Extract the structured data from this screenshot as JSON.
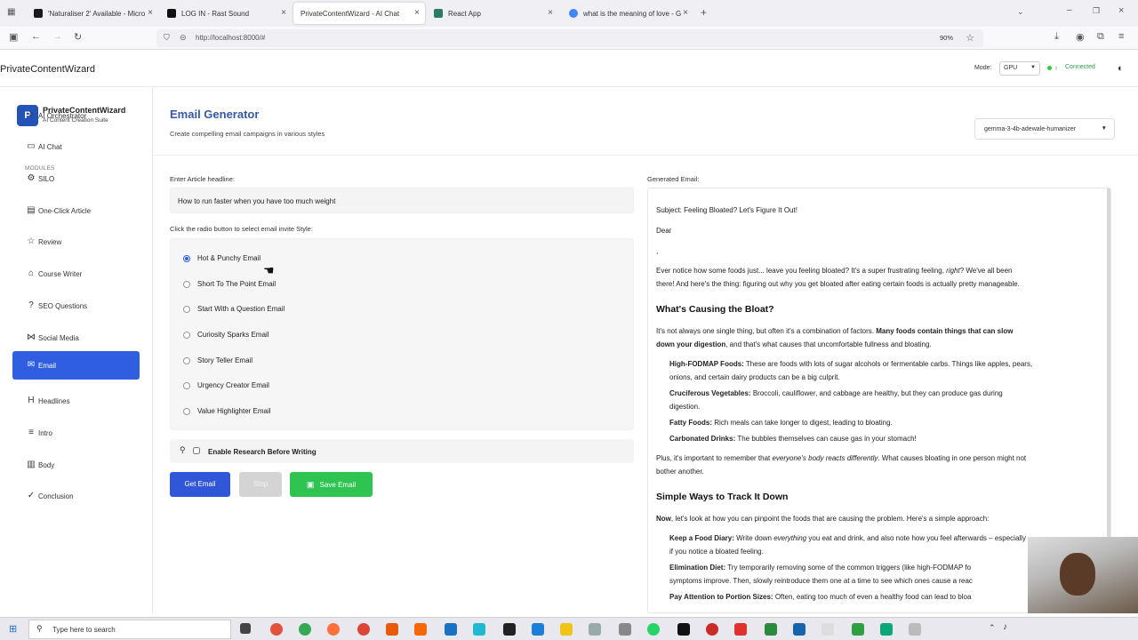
{
  "browser": {
    "tabs": [
      {
        "label": "'Naturaliser 2' Available - Micro",
        "color": "#1a1a1a"
      },
      {
        "label": "LOG IN - Rast Sound",
        "color": "#111111"
      },
      {
        "label": "PrivateContentWizard - AI Chat",
        "color": "#ffffff"
      },
      {
        "label": "React App",
        "color": "#2a7d5f"
      },
      {
        "label": "what is the meaning of love - G",
        "color": "#4285f4"
      }
    ],
    "url": "http://localhost:8000/#",
    "zoom": "90%"
  },
  "app": {
    "title": "PrivateContentWizard",
    "mode_label": "Mode:",
    "mode_value": "GPU",
    "status": "Connected"
  },
  "sidebar": {
    "brand_name": "PrivateContentWizard",
    "brand_sub": "AI Content Creation Suite",
    "logo_letter": "P",
    "modules_label": "MODULES",
    "items": [
      {
        "label": "AI Orchestrator",
        "icon": "sparkle-icon",
        "glyph": "✧"
      },
      {
        "label": "AI Chat",
        "icon": "chat-icon",
        "glyph": "▭"
      },
      {
        "label": "SILO",
        "icon": "silo-icon",
        "glyph": "⚙"
      },
      {
        "label": "One-Click Article",
        "icon": "document-icon",
        "glyph": "▤"
      },
      {
        "label": "Review",
        "icon": "star-icon",
        "glyph": "☆"
      },
      {
        "label": "Course Writer",
        "icon": "course-icon",
        "glyph": "⌂"
      },
      {
        "label": "SEO Questions",
        "icon": "question-icon",
        "glyph": "?"
      },
      {
        "label": "Social Media",
        "icon": "share-icon",
        "glyph": "⋈"
      },
      {
        "label": "Email",
        "icon": "mail-icon",
        "glyph": "✉"
      },
      {
        "label": "Headlines",
        "icon": "heading-icon",
        "glyph": "H"
      },
      {
        "label": "Intro",
        "icon": "intro-icon",
        "glyph": "≡"
      },
      {
        "label": "Body",
        "icon": "body-icon",
        "glyph": "▥"
      },
      {
        "label": "Conclusion",
        "icon": "check-circle-icon",
        "glyph": "✓"
      }
    ],
    "active_index": 8
  },
  "main": {
    "title": "Email Generator",
    "subtitle": "Create compelling email campaigns in various styles",
    "model": "gemma-3-4b-adewale-humanizer",
    "headline_label": "Enter Article headline:",
    "headline_value": "How to run faster when you have too much weight",
    "style_label": "Click the radio button to select email invite Style:",
    "styles": [
      "Hot & Punchy Email",
      "Short To The Point Email",
      "Start With a Question Email",
      "Curiosity Sparks Email",
      "Story Teller Email",
      "Urgency Creator Email",
      "Value Highlighter Email"
    ],
    "selected_style": 0,
    "research_label": "Enable Research Before Writing",
    "buttons": {
      "get": "Get Email",
      "stop": "Stop",
      "save": "Save Email"
    }
  },
  "email": {
    "label": "Generated Email:",
    "subject": "Subject: Feeling Bloated? Let's Figure It Out!",
    "greeting": "Dear",
    "comma": ",",
    "intro_a": "Ever notice how some foods just... leave you feeling bloated? It's a super frustrating feeling, ",
    "intro_i": "right",
    "intro_b": "? We've all been",
    "intro_2": "there! And here's the thing: figuring out why you get bloated after eating certain foods is actually pretty manageable.",
    "h1": "What's Causing the Bloat?",
    "p1_a": "It's not always one single thing, but often it's a combination of factors. ",
    "p1_b": "Many foods contain things that can slow",
    "p1_c": "down your digestion",
    "p1_d": ", and that's what causes that uncomfortable fullness and bloating.",
    "fodmap_b": "High-FODMAP Foods:",
    "fodmap_t": " These are foods with lots of sugar alcohols or fermentable carbs. Things like apples, pears,",
    "fodmap_2": "onions, and certain dairy products can be a big culprit.",
    "cruc_b": "Cruciferous Vegetables:",
    "cruc_t": " Broccoli, cauliflower, and cabbage are healthy, but they can produce gas during",
    "cruc_2": "digestion.",
    "fatty_b": "Fatty Foods:",
    "fatty_t": " Rich meals can take longer to digest, leading to bloating.",
    "carb_b": "Carbonated Drinks:",
    "carb_t": " The bubbles themselves can cause gas in your stomach!",
    "plus_a": "Plus, it's important to remember that ",
    "plus_i": "everyone's body reacts differently",
    "plus_b": ". What causes bloating in one person might not",
    "plus_2": "bother another.",
    "h2": "Simple Ways to Track It Down",
    "now_b": "Now",
    "now_t": ", let's look at how you can pinpoint the foods that are causing the problem. Here's a simple approach:",
    "diary_b": "Keep a Food Diary:",
    "diary_t1": " Write down ",
    "diary_i": "everything",
    "diary_t2": " you eat and drink, and also note how you feel afterwards – especially",
    "diary_2": "if you notice a bloated feeling.",
    "elim_b": "Elimination Diet:",
    "elim_t": " Try temporarily removing some of the common triggers (like high-FODMAP fo",
    "elim_2": "symptoms improve. Then, slowly reintroduce them one at a time to see which ones cause a reac",
    "port_b": "Pay Attention to Portion Sizes:",
    "port_t": " Often, eating too much of even a healthy food can lead to bloa"
  },
  "taskbar": {
    "search_placeholder": "Type here to search"
  },
  "colors": {
    "accent": "#2f5fe0",
    "title_blue": "#3558a8",
    "save_green": "#2fc452",
    "status_green": "#2ecc40"
  }
}
